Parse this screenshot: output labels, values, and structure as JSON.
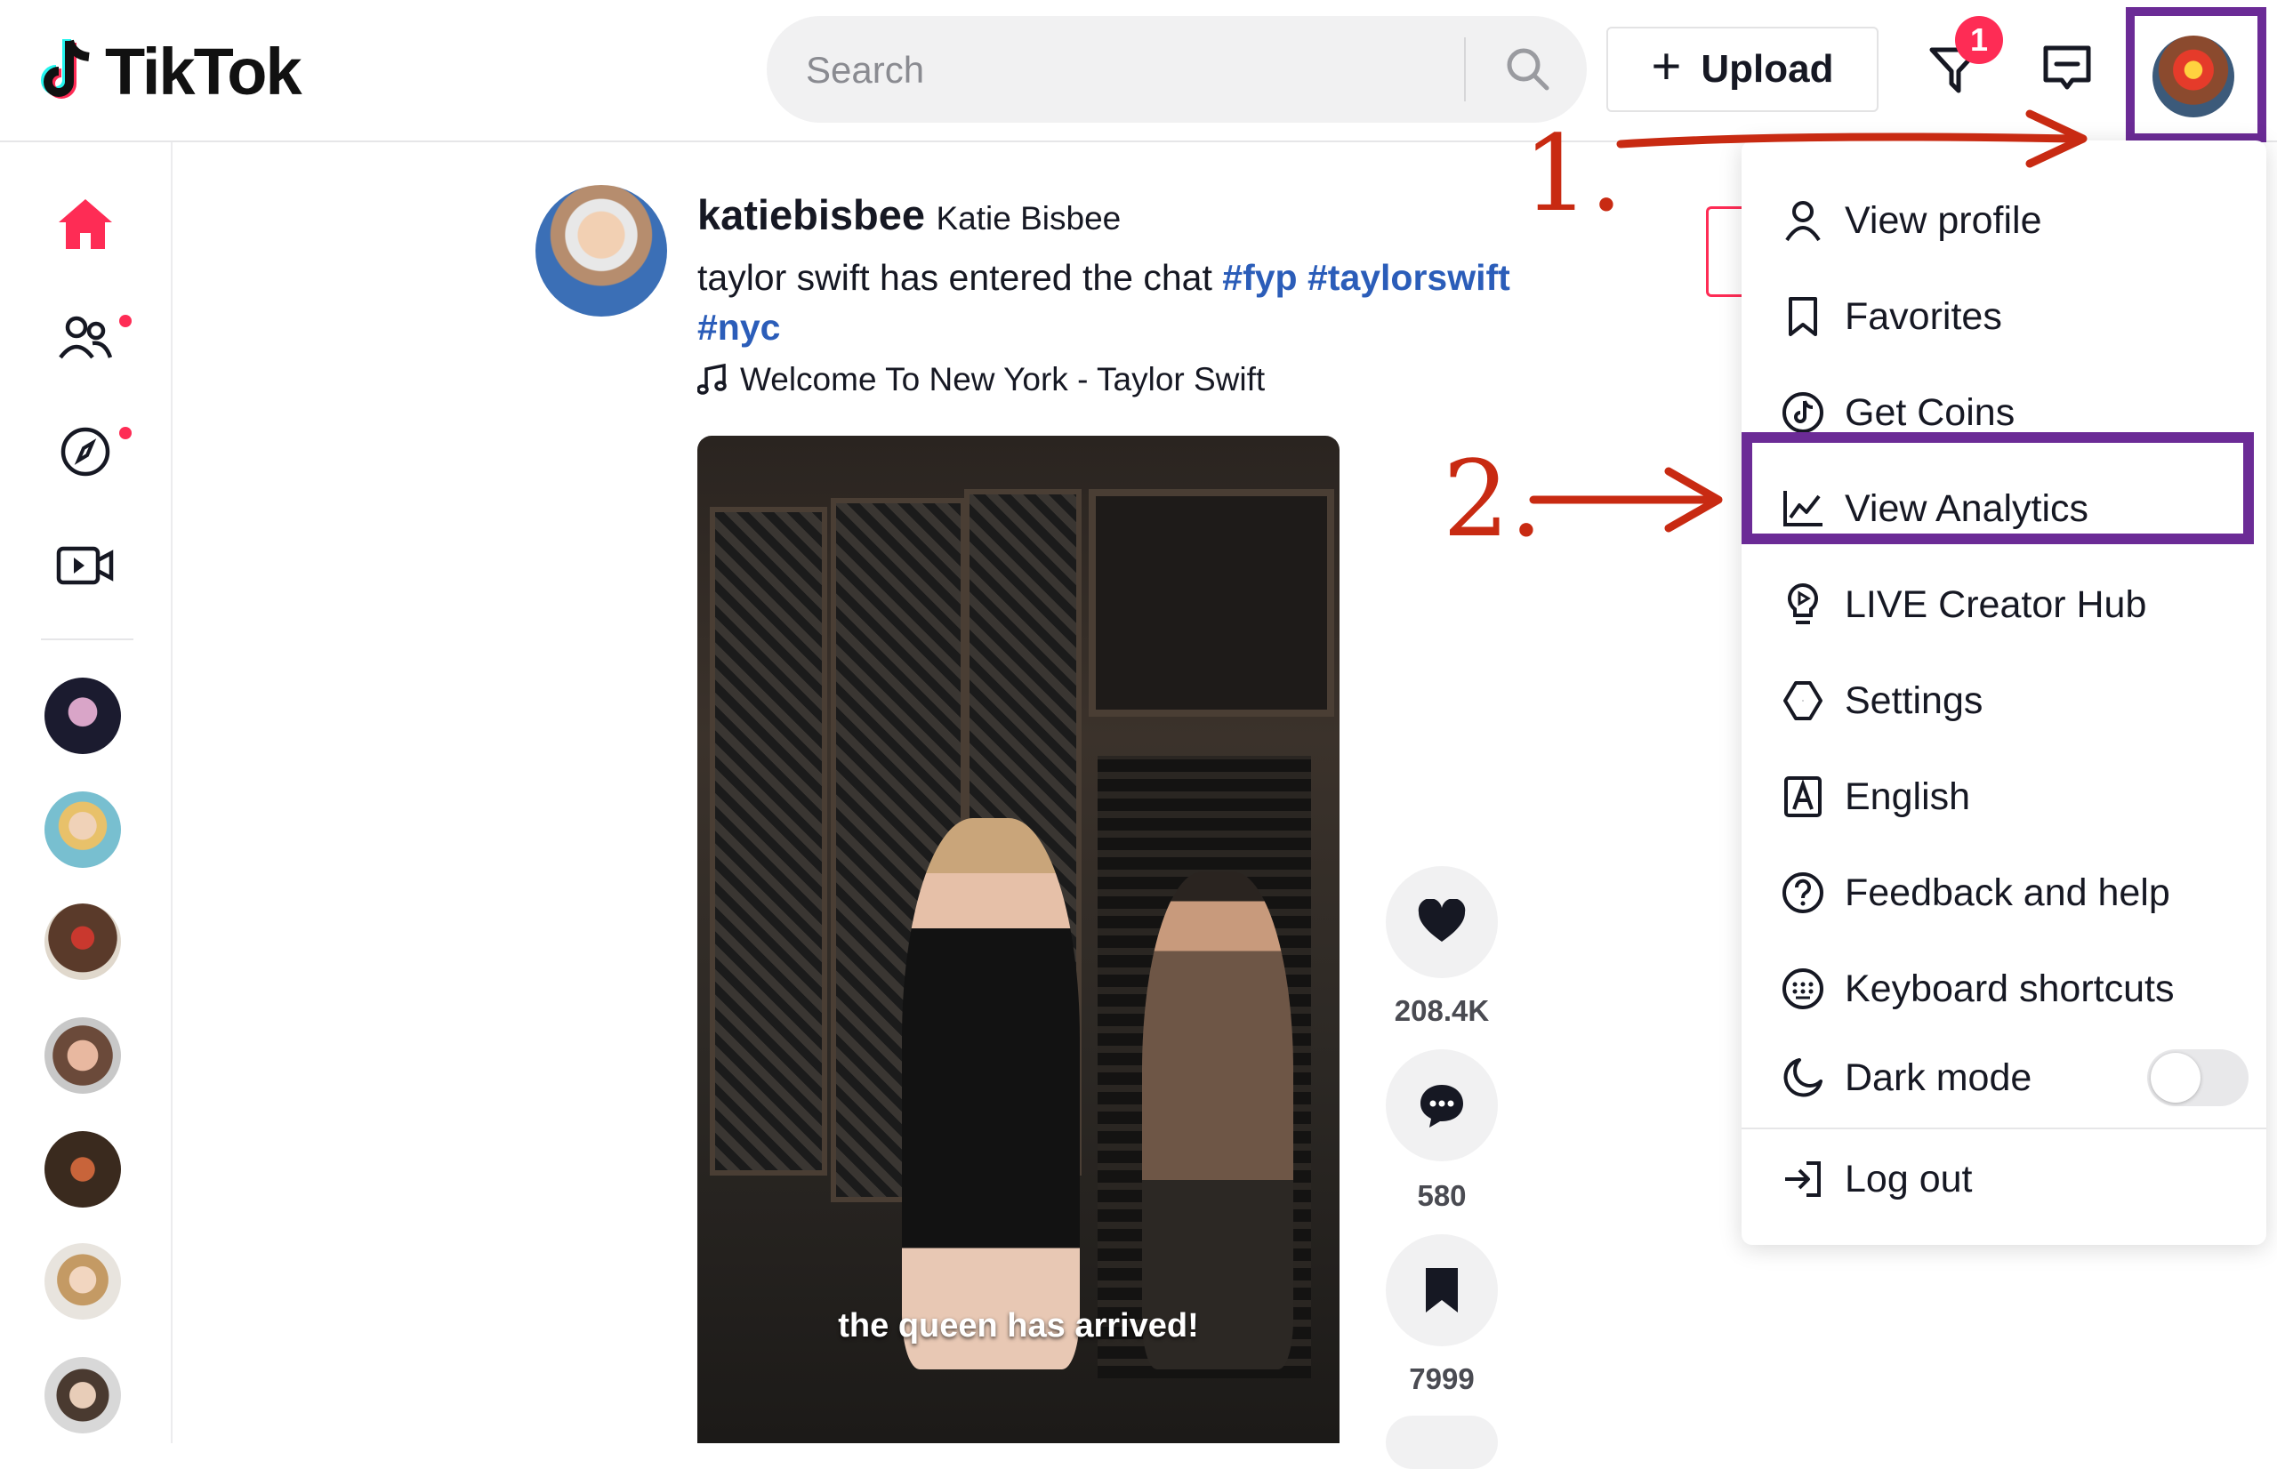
{
  "header": {
    "logo_text": "TikTok",
    "search_placeholder": "Search",
    "upload_label": "Upload",
    "inbox_badge": "1"
  },
  "post": {
    "handle": "katiebisbee",
    "display_name": "Katie Bisbee",
    "caption_text": "taylor swift has entered the chat ",
    "hashtags": [
      "#fyp",
      "#taylorswift",
      "#nyc"
    ],
    "music": "Welcome To New York - Taylor Swift",
    "video_caption": "the queen has arrived!",
    "likes": "208.4K",
    "comments": "580",
    "saves": "7999"
  },
  "menu": {
    "items": [
      {
        "label": "View profile",
        "icon": "person-icon"
      },
      {
        "label": "Favorites",
        "icon": "bookmark-icon"
      },
      {
        "label": "Get Coins",
        "icon": "tiktok-coin-icon"
      },
      {
        "label": "View Analytics",
        "icon": "chart-icon"
      },
      {
        "label": "LIVE Creator Hub",
        "icon": "lightbulb-icon"
      },
      {
        "label": "Settings",
        "icon": "gear-icon"
      },
      {
        "label": "English",
        "icon": "language-a-icon"
      },
      {
        "label": "Feedback and help",
        "icon": "question-icon"
      },
      {
        "label": "Keyboard shortcuts",
        "icon": "keyboard-icon"
      },
      {
        "label": "Dark mode",
        "icon": "moon-icon"
      },
      {
        "label": "Log out",
        "icon": "logout-icon"
      }
    ],
    "dark_mode_on": false
  },
  "annotations": {
    "step1": "1.",
    "step2": "2."
  },
  "colors": {
    "brand_red": "#fe2c55",
    "highlight_purple": "#6b2b96",
    "annotation_red": "#c82a12",
    "hashtag_blue": "#2b5db9"
  }
}
